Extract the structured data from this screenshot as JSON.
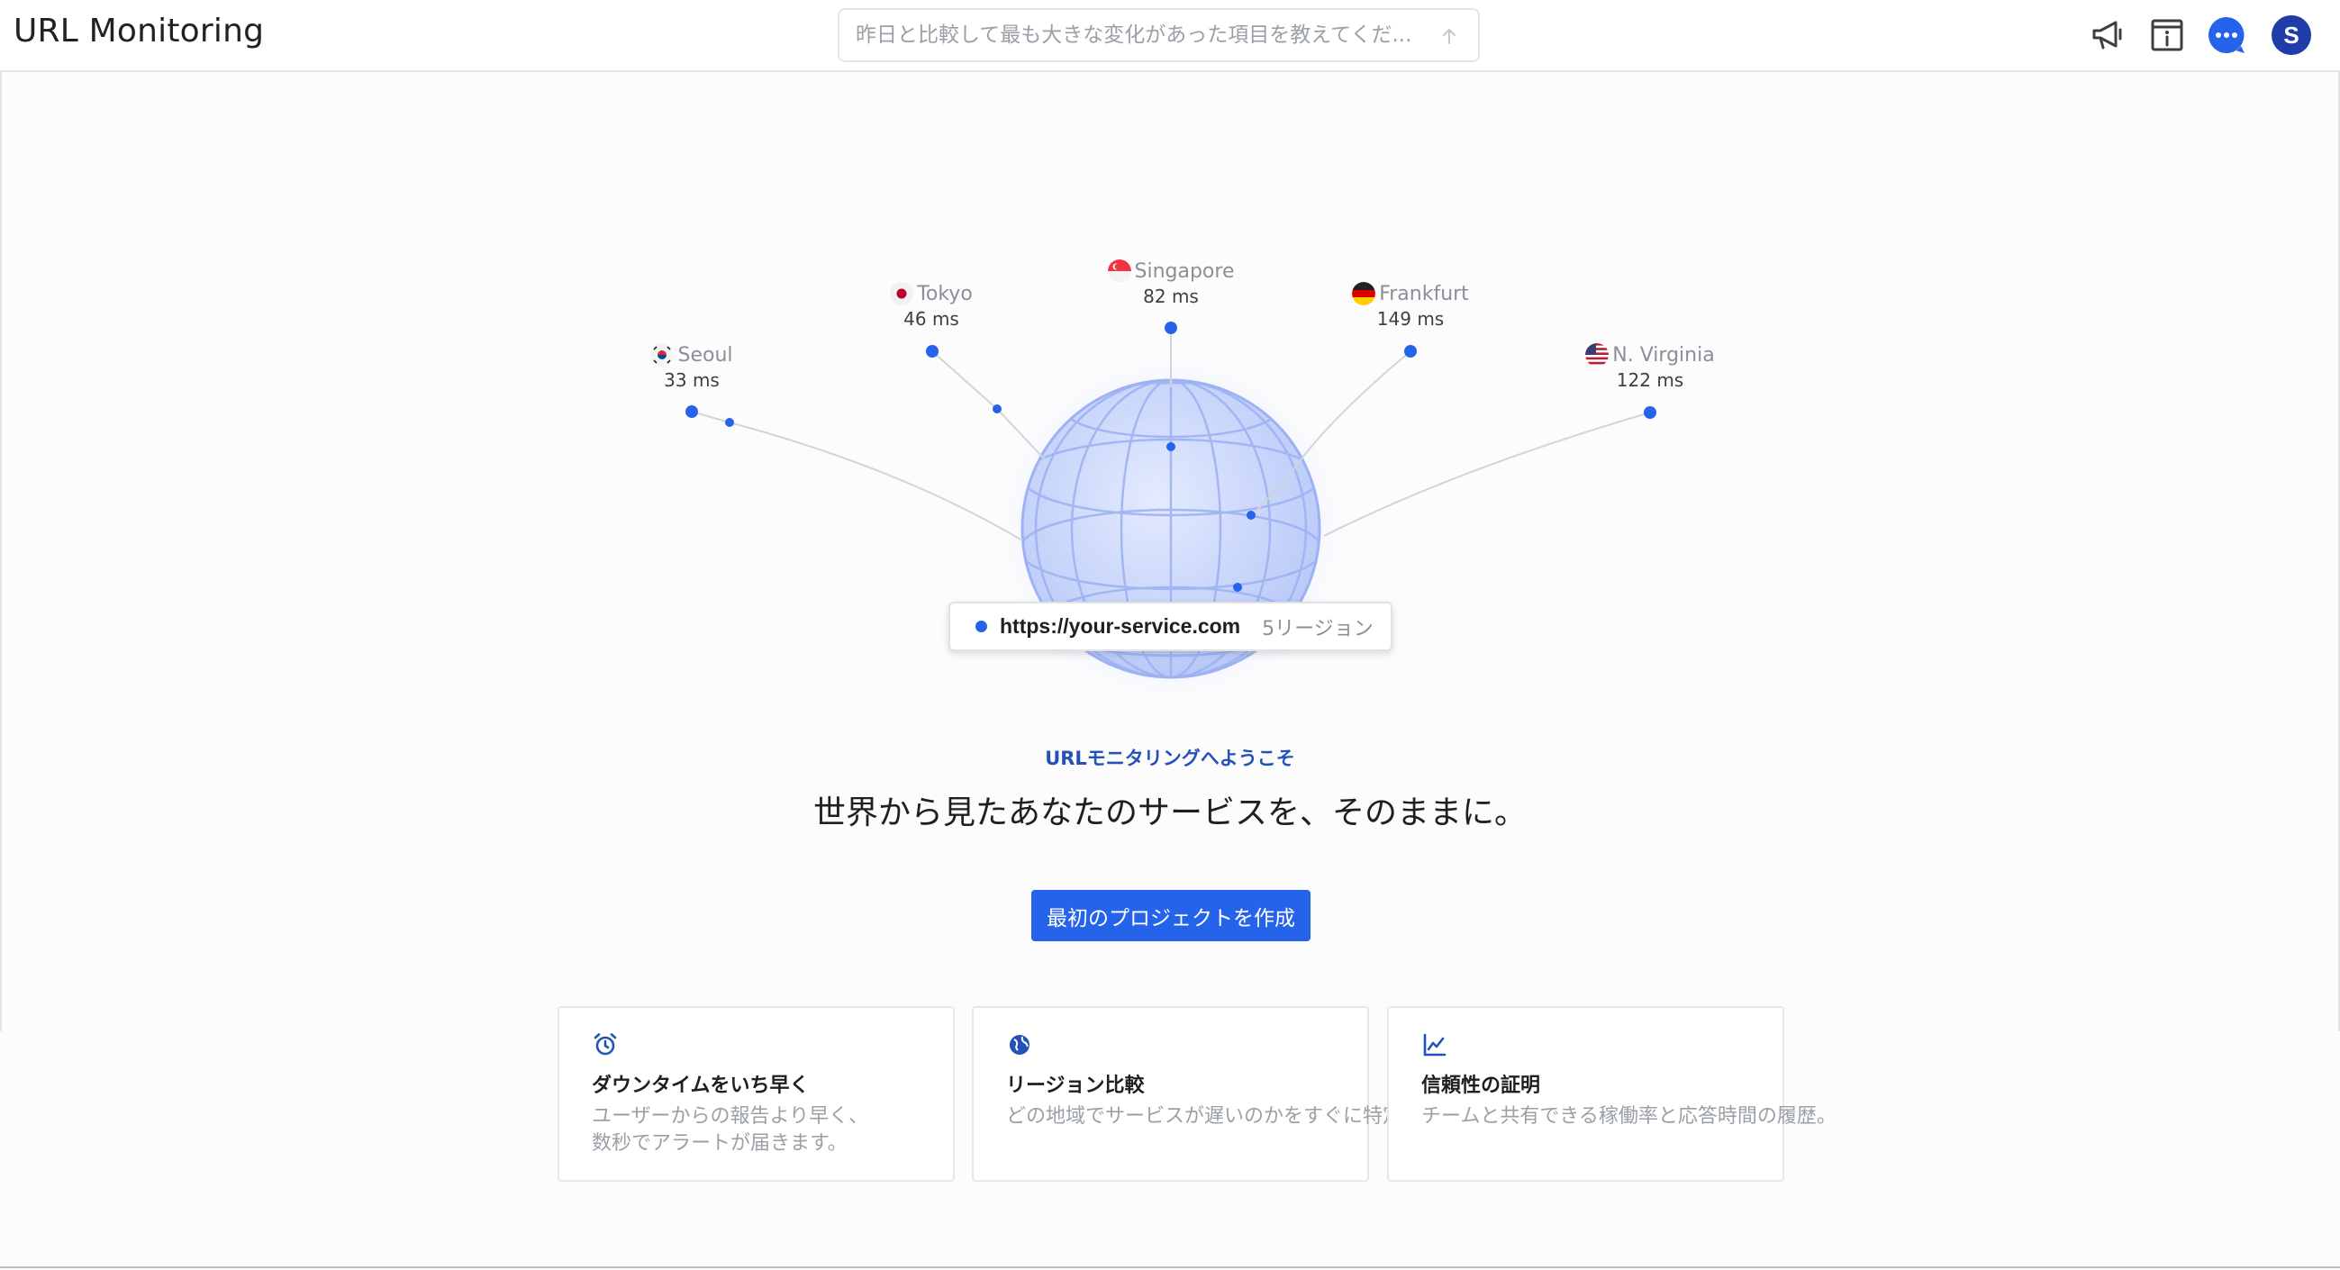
{
  "header": {
    "app_title": "URL Monitoring",
    "ask_placeholder": "昨日と比較して最も大きな変化があった項目を教えてくだ...",
    "ask_value": "",
    "icons": [
      "megaphone-icon",
      "info-panel-icon",
      "chat-bubble-icon"
    ],
    "avatar_initial": "S"
  },
  "regions": [
    {
      "name": "Seoul",
      "latency": "33 ms",
      "flag": "kr"
    },
    {
      "name": "Tokyo",
      "latency": "46 ms",
      "flag": "jp"
    },
    {
      "name": "Singapore",
      "latency": "82 ms",
      "flag": "sg"
    },
    {
      "name": "Frankfurt",
      "latency": "149 ms",
      "flag": "de"
    },
    {
      "name": "N. Virginia",
      "latency": "122 ms",
      "flag": "us"
    }
  ],
  "target": {
    "url": "https://your-service.com",
    "region_count": "5リージョン"
  },
  "hero": {
    "kicker": "URLモニタリングへようこそ",
    "headline": "世界から見たあなたのサービスを、そのままに。",
    "cta_label": "最初のプロジェクトを作成"
  },
  "features": [
    {
      "icon": "alarm-clock-icon",
      "title": "ダウンタイムをいち早く",
      "body": "ユーザーからの報告より早く、\n数秒でアラートが届きます。"
    },
    {
      "icon": "globe-icon",
      "title": "リージョン比較",
      "body": "どの地域でサービスが遅いのかをすぐに特定。"
    },
    {
      "icon": "line-chart-icon",
      "title": "信頼性の証明",
      "body": "チームと共有できる稼働率と応答時間の履歴。"
    }
  ],
  "colors": {
    "accent": "#2563eb",
    "avatar": "#1f3da8",
    "globe": "#c9d6fb"
  }
}
